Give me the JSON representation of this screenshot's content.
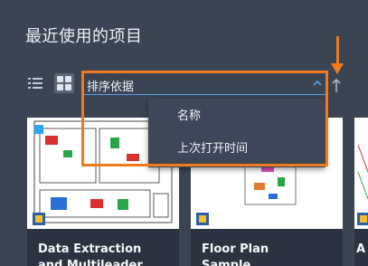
{
  "page": {
    "title": "最近使用的项目"
  },
  "toolbar": {
    "list_view_icon": "list-icon",
    "grid_view_icon": "grid-icon",
    "sort_label": "排序依据",
    "sort_chevron_icon": "chevron-up-icon",
    "sort_direction_icon": "arrow-up-icon"
  },
  "sort_menu": {
    "items": [
      {
        "label": "名称"
      },
      {
        "label": "上次打开时间"
      }
    ]
  },
  "files": [
    {
      "title_line1": "Data Extraction",
      "title_line2": "and Multileader"
    },
    {
      "title_line1": "Floor Plan",
      "title_line2": "Sample"
    },
    {
      "title_line1": "A",
      "title_line2": ""
    }
  ],
  "colors": {
    "background": "#3b4453",
    "annotation": "#f07a1c",
    "accent": "#5aa0e6",
    "card": "#2c3340"
  }
}
